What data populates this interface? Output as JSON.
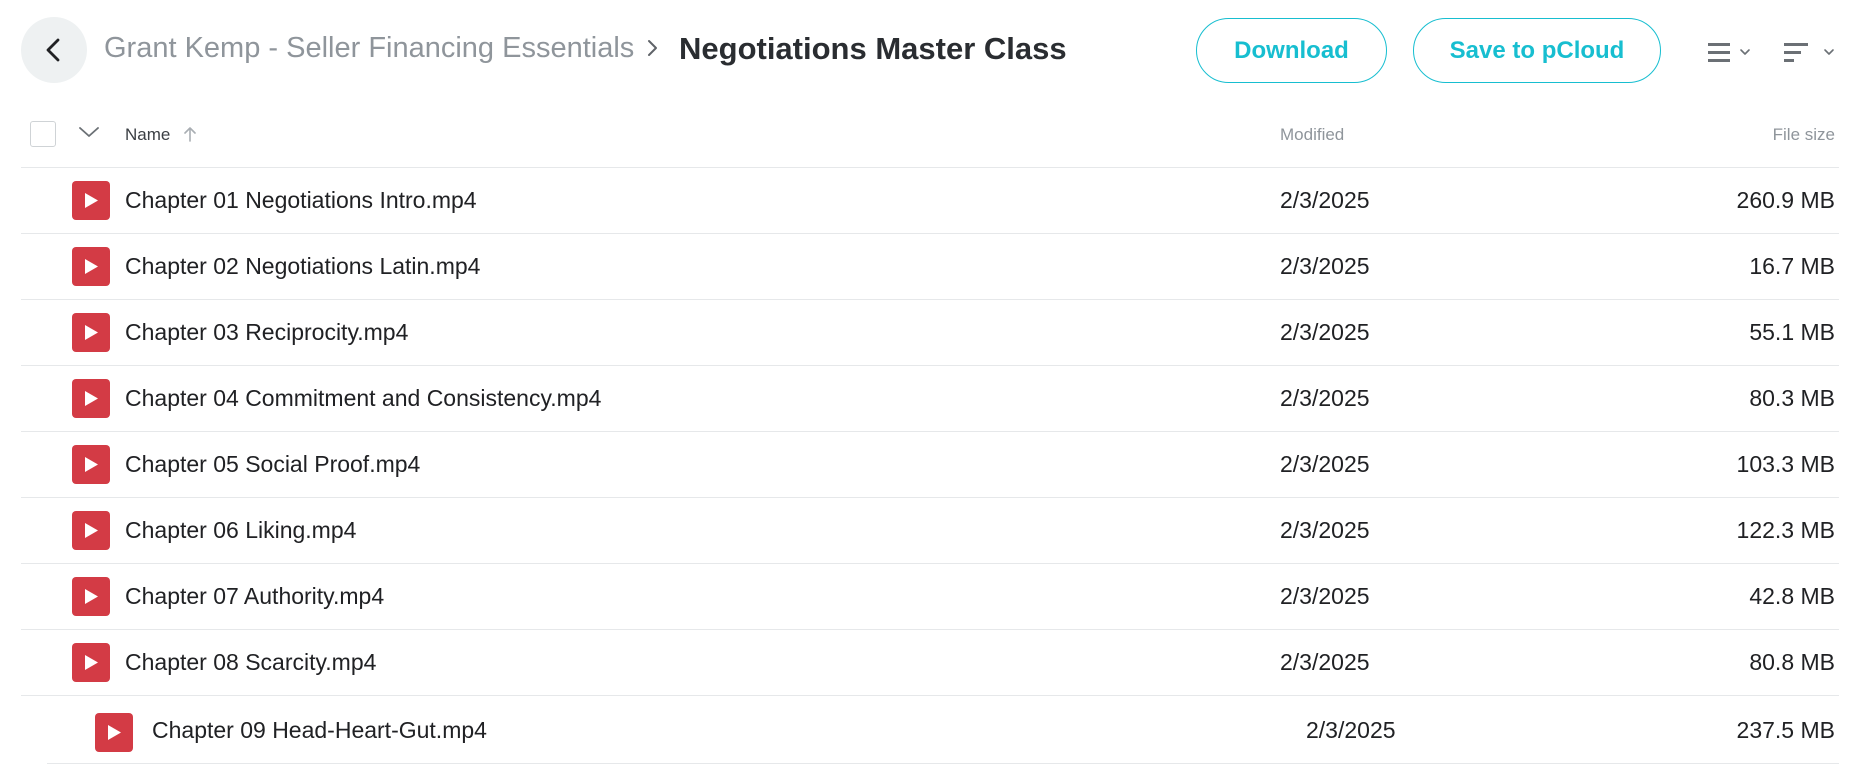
{
  "breadcrumb": {
    "parent": "Grant Kemp - Seller Financing Essentials",
    "current": "Negotiations Master Class"
  },
  "toolbar": {
    "download_label": "Download",
    "save_label": "Save to pCloud",
    "view_icon": "list-view-icon",
    "sort_icon": "sort-icon"
  },
  "table": {
    "columns": {
      "name": "Name",
      "modified": "Modified",
      "size": "File size"
    },
    "sort": {
      "column": "Name",
      "direction": "ascending"
    },
    "rows": [
      {
        "name": "Chapter 01 Negotiations Intro.mp4",
        "modified": "2/3/2025",
        "size": "260.9 MB",
        "icon": "video-file-icon"
      },
      {
        "name": "Chapter 02 Negotiations Latin.mp4",
        "modified": "2/3/2025",
        "size": "16.7 MB",
        "icon": "video-file-icon"
      },
      {
        "name": "Chapter 03 Reciprocity.mp4",
        "modified": "2/3/2025",
        "size": "55.1 MB",
        "icon": "video-file-icon"
      },
      {
        "name": "Chapter 04 Commitment and Consistency.mp4",
        "modified": "2/3/2025",
        "size": "80.3 MB",
        "icon": "video-file-icon"
      },
      {
        "name": "Chapter 05 Social Proof.mp4",
        "modified": "2/3/2025",
        "size": "103.3 MB",
        "icon": "video-file-icon"
      },
      {
        "name": "Chapter 06 Liking.mp4",
        "modified": "2/3/2025",
        "size": "122.3 MB",
        "icon": "video-file-icon"
      },
      {
        "name": "Chapter 07 Authority.mp4",
        "modified": "2/3/2025",
        "size": "42.8 MB",
        "icon": "video-file-icon"
      },
      {
        "name": "Chapter 08 Scarcity.mp4",
        "modified": "2/3/2025",
        "size": "80.8 MB",
        "icon": "video-file-icon"
      },
      {
        "name": "Chapter 09 Head-Heart-Gut.mp4",
        "modified": "2/3/2025",
        "size": "237.5 MB",
        "icon": "video-file-icon"
      }
    ]
  },
  "colors": {
    "accent": "#17bed0",
    "video_icon": "#d33b45",
    "muted_text": "#8f959b",
    "divider": "#e6e8ea"
  }
}
